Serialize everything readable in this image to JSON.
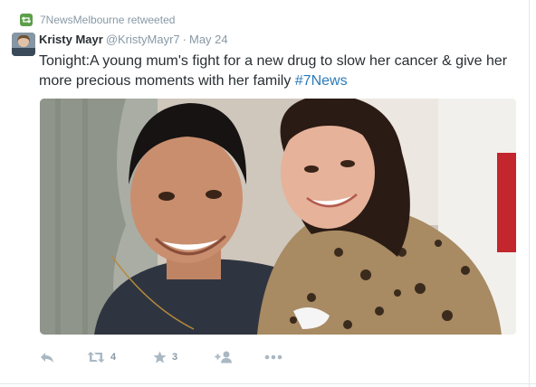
{
  "context": {
    "text": "7NewsMelbourne retweeted",
    "icon": "retweet-icon",
    "color": "#5c9f4b"
  },
  "tweet": {
    "author_name": "Kristy Mayr",
    "handle": "@KristyMayr7",
    "separator": "·",
    "time": "May 24",
    "text": "Tonight:A young mum's fight for a new drug to slow her cancer & give her more precious moments with her family ",
    "hashtag": "#7News",
    "hashtag_color": "#2b7bb9"
  },
  "actions": {
    "reply": {
      "icon": "reply-icon"
    },
    "retweet": {
      "icon": "retweet-icon",
      "count": "4"
    },
    "favorite": {
      "icon": "star-icon",
      "count": "3"
    },
    "follow": {
      "icon": "add-user-icon"
    },
    "more": {
      "icon": "more-icon"
    }
  },
  "colors": {
    "muted": "#8899a6",
    "icon": "#aab8c2",
    "text": "#292f33",
    "border": "#e1e8ed"
  }
}
